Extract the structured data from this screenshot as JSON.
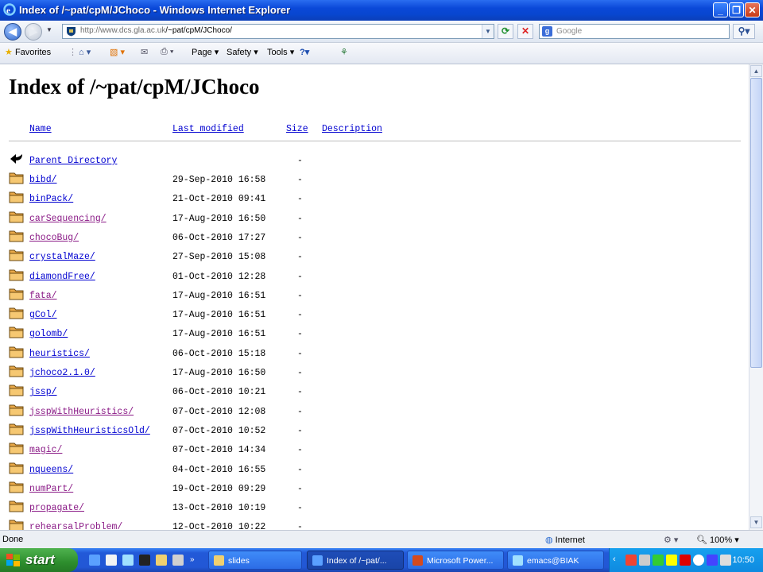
{
  "window": {
    "title": "Index of /~pat/cpM/JChoco - Windows Internet Explorer"
  },
  "address": {
    "url_host": "http://www.dcs.gla.ac.uk",
    "url_path": "/~pat/cpM/JChoco/"
  },
  "search": {
    "placeholder": "Google"
  },
  "commandbar": {
    "favorites": "Favorites",
    "page": "Page",
    "safety": "Safety",
    "tools": "Tools"
  },
  "page": {
    "heading": "Index of /~pat/cpM/JChoco",
    "columns": {
      "name": "Name",
      "last_modified": "Last modified",
      "size": "Size",
      "description": "Description"
    },
    "parent": {
      "name": "Parent Directory",
      "size": "-"
    },
    "rows": [
      {
        "name": "bibd/",
        "date": "29-Sep-2010 16:58",
        "size": "-",
        "visited": false
      },
      {
        "name": "binPack/",
        "date": "21-Oct-2010 09:41",
        "size": "-",
        "visited": false
      },
      {
        "name": "carSequencing/",
        "date": "17-Aug-2010 16:50",
        "size": "-",
        "visited": true
      },
      {
        "name": "chocoBug/",
        "date": "06-Oct-2010 17:27",
        "size": "-",
        "visited": true
      },
      {
        "name": "crystalMaze/",
        "date": "27-Sep-2010 15:08",
        "size": "-",
        "visited": false
      },
      {
        "name": "diamondFree/",
        "date": "01-Oct-2010 12:28",
        "size": "-",
        "visited": false
      },
      {
        "name": "fata/",
        "date": "17-Aug-2010 16:51",
        "size": "-",
        "visited": true
      },
      {
        "name": "gCol/",
        "date": "17-Aug-2010 16:51",
        "size": "-",
        "visited": false
      },
      {
        "name": "golomb/",
        "date": "17-Aug-2010 16:51",
        "size": "-",
        "visited": false
      },
      {
        "name": "heuristics/",
        "date": "06-Oct-2010 15:18",
        "size": "-",
        "visited": false
      },
      {
        "name": "jchoco2.1.0/",
        "date": "17-Aug-2010 16:50",
        "size": "-",
        "visited": false
      },
      {
        "name": "jssp/",
        "date": "06-Oct-2010 10:21",
        "size": "-",
        "visited": false
      },
      {
        "name": "jsspWithHeuristics/",
        "date": "07-Oct-2010 12:08",
        "size": "-",
        "visited": true
      },
      {
        "name": "jsspWithHeuristicsOld/",
        "date": "07-Oct-2010 10:52",
        "size": "-",
        "visited": false
      },
      {
        "name": "magic/",
        "date": "07-Oct-2010 14:34",
        "size": "-",
        "visited": true
      },
      {
        "name": "nqueens/",
        "date": "04-Oct-2010 16:55",
        "size": "-",
        "visited": false
      },
      {
        "name": "numPart/",
        "date": "19-Oct-2010 09:29",
        "size": "-",
        "visited": true
      },
      {
        "name": "propagate/",
        "date": "13-Oct-2010 10:19",
        "size": "-",
        "visited": true
      },
      {
        "name": "rehearsalProblem/",
        "date": "12-Oct-2010 10:22",
        "size": "-",
        "visited": true
      }
    ]
  },
  "status": {
    "text": "Done",
    "zone": "Internet",
    "zoom": "100%"
  },
  "taskbar": {
    "start": "start",
    "tasks": [
      "slides",
      "Index of /~pat/...",
      "Microsoft Power...",
      "emacs@BIAK"
    ],
    "time": "10:50"
  },
  "colors": {
    "link": "#0000d0",
    "visited": "#8a1a86",
    "titlebar": "#0a48d8",
    "start": "#2d8e2d"
  }
}
